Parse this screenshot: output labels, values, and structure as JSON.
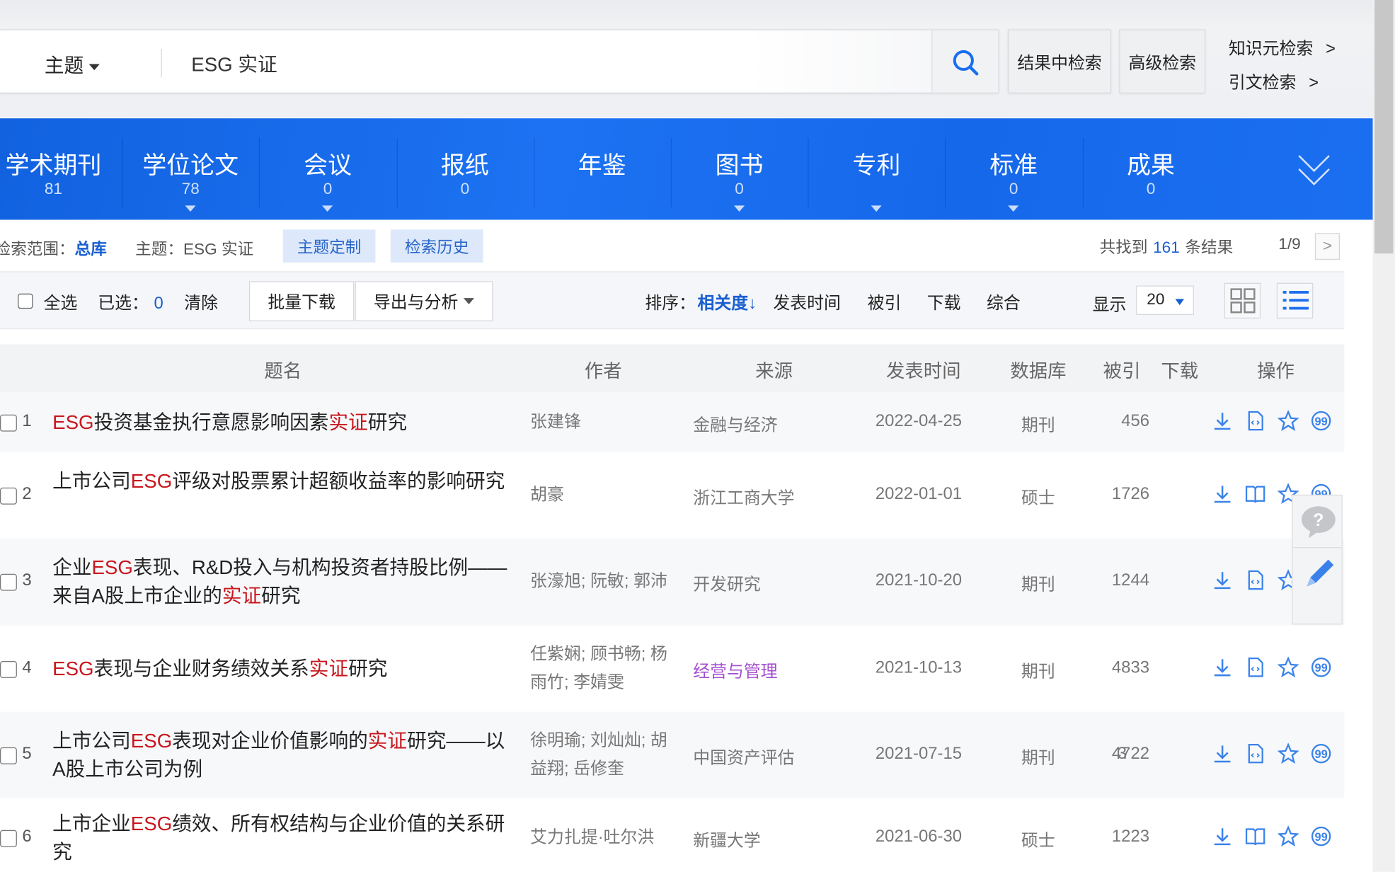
{
  "search": {
    "field": "主题",
    "query": "ESG 实证",
    "within_results": "结果中检索",
    "advanced": "高级检索",
    "knowledge_search": "知识元检索",
    "citation_search": "引文检索",
    "link_arrow": ">"
  },
  "tabs": [
    {
      "label": "学术期刊",
      "count": "81",
      "dropdown": false
    },
    {
      "label": "学位论文",
      "count": "78",
      "dropdown": true
    },
    {
      "label": "会议",
      "count": "0",
      "dropdown": true
    },
    {
      "label": "报纸",
      "count": "0",
      "dropdown": false
    },
    {
      "label": "年鉴",
      "count": "",
      "dropdown": false
    },
    {
      "label": "图书",
      "count": "0",
      "dropdown": true
    },
    {
      "label": "专利",
      "count": "",
      "dropdown": true
    },
    {
      "label": "标准",
      "count": "0",
      "dropdown": true
    },
    {
      "label": "成果",
      "count": "0",
      "dropdown": false
    }
  ],
  "filters": {
    "scope_label": "检索范围：",
    "scope_value": "总库",
    "topic_label": "主题：",
    "topic_value": "ESG 实证",
    "customize": "主题定制",
    "history": "检索历史",
    "found_prefix": "共找到",
    "found_count": "161",
    "found_suffix": "条结果",
    "page": "1/9",
    "next": ">"
  },
  "toolbar": {
    "select_all": "全选",
    "selected_label": "已选：",
    "selected_count": "0",
    "clear": "清除",
    "batch_download": "批量下载",
    "export": "导出与分析",
    "sort_label": "排序：",
    "sort_relevance": "相关度",
    "sort_arrow": "↓",
    "sort_date": "发表时间",
    "sort_cited": "被引",
    "sort_download": "下载",
    "sort_overall": "综合",
    "display_label": "显示",
    "page_size": "20",
    "view_mode": "list"
  },
  "table": {
    "headers": {
      "title": "题名",
      "author": "作者",
      "source": "来源",
      "date": "发表时间",
      "db": "数据库",
      "cited": "被引",
      "downloads": "下载",
      "ops": "操作"
    },
    "rows": [
      {
        "num": "1",
        "title": [
          [
            "ESG",
            1
          ],
          [
            "投资基金执行意愿影响因素",
            0
          ],
          [
            "实证",
            1
          ],
          [
            "研究",
            0
          ]
        ],
        "author": "张建锋",
        "source": "金融与经济",
        "visited": false,
        "date": "2022-04-25",
        "db": "期刊",
        "cited": "",
        "downloads": "456",
        "type": "journal"
      },
      {
        "num": "2",
        "title": [
          [
            "上市公司",
            0
          ],
          [
            "ESG",
            1
          ],
          [
            "评级对股票累计超额收益率的影响研究",
            0
          ]
        ],
        "author": "胡豪",
        "source": "浙江工商大学",
        "visited": false,
        "date": "2022-01-01",
        "db": "硕士",
        "cited": "",
        "downloads": "1726",
        "type": "thesis"
      },
      {
        "num": "3",
        "title": [
          [
            "企业",
            0
          ],
          [
            "ESG",
            1
          ],
          [
            "表现、R&D投入与机构投资者持股比例——来自A股上市企业的",
            0
          ],
          [
            "实证",
            1
          ],
          [
            "研究",
            0
          ]
        ],
        "author": "张濠旭; 阮敏; 郭沛",
        "source": "开发研究",
        "visited": false,
        "date": "2021-10-20",
        "db": "期刊",
        "cited": "",
        "downloads": "1244",
        "type": "journal"
      },
      {
        "num": "4",
        "title": [
          [
            "ESG",
            1
          ],
          [
            "表现与企业财务绩效关系",
            0
          ],
          [
            "实证",
            1
          ],
          [
            "研究",
            0
          ]
        ],
        "author": "任紫娴; 顾书畅; 杨雨竹; 李婧雯",
        "source": "经营与管理",
        "visited": true,
        "date": "2021-10-13",
        "db": "期刊",
        "cited": "",
        "downloads": "4833",
        "type": "journal"
      },
      {
        "num": "5",
        "title": [
          [
            "上市公司",
            0
          ],
          [
            "ESG",
            1
          ],
          [
            "表现对企业价值影响的",
            0
          ],
          [
            "实证",
            1
          ],
          [
            "研究——以A股上市公司为例",
            0
          ]
        ],
        "author": "徐明瑜; 刘灿灿; 胡益翔; 岳修奎",
        "source": "中国资产评估",
        "visited": false,
        "date": "2021-07-15",
        "db": "期刊",
        "cited": "3",
        "downloads": "4722",
        "type": "journal"
      },
      {
        "num": "6",
        "title": [
          [
            "上市企业",
            0
          ],
          [
            "ESG",
            1
          ],
          [
            "绩效、所有权结构与企业价值的关系研究",
            0
          ]
        ],
        "author": "艾力扎提·吐尔洪",
        "source": "新疆大学",
        "visited": false,
        "date": "2021-06-30",
        "db": "硕士",
        "cited": "",
        "downloads": "1223",
        "type": "thesis"
      }
    ]
  },
  "colors": {
    "brand_blue": "#1a6ff0",
    "highlight_red": "#c8161d",
    "link_blue": "#1a5fd0",
    "visited_purple": "#a44fd0"
  }
}
